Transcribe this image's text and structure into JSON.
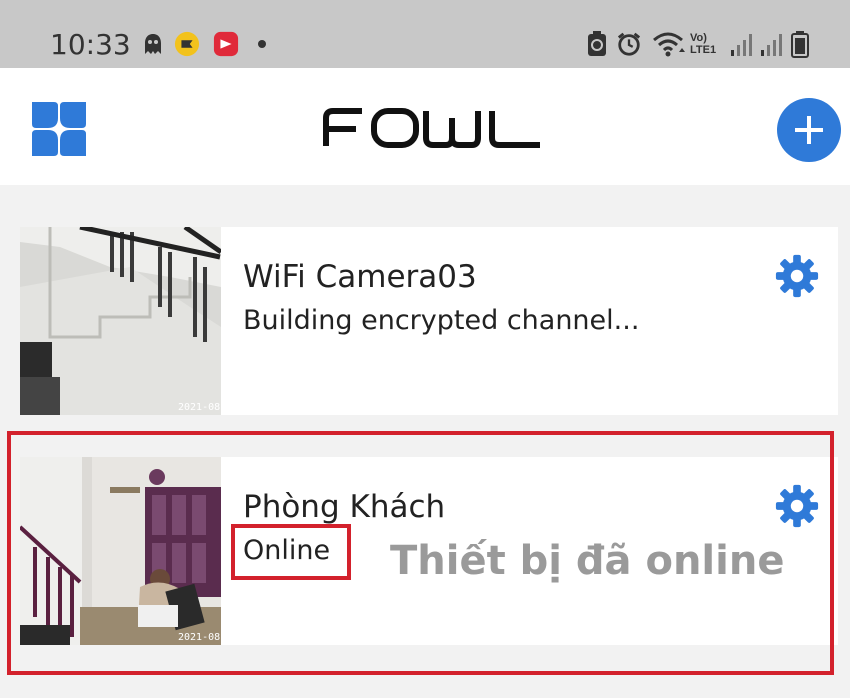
{
  "status_bar": {
    "time": "10:33",
    "icons": [
      "ghost-icon",
      "chat-app-icon",
      "video-app-icon",
      "notification-dot",
      "battery-saver-icon",
      "alarm-icon",
      "wifi-icon",
      "volte-icon",
      "signal-icon",
      "signal-icon",
      "battery-icon"
    ],
    "volte_label": "Vo) LTE1"
  },
  "header": {
    "logo_text": "FOWL",
    "menu_icon": "grid-menu-icon",
    "add_icon": "plus-icon",
    "accent_color": "#2f7ad8"
  },
  "devices": [
    {
      "name": "WiFi Camera03",
      "status": "Building encrypted channel...",
      "timestamp": "2021-08",
      "settings_icon": "gear-icon"
    },
    {
      "name": "Phòng Khách",
      "status": "Online",
      "timestamp": "2021-08",
      "settings_icon": "gear-icon"
    }
  ],
  "annotation": {
    "text": "Thiết bị đã online",
    "highlight_color": "#d3212c"
  }
}
